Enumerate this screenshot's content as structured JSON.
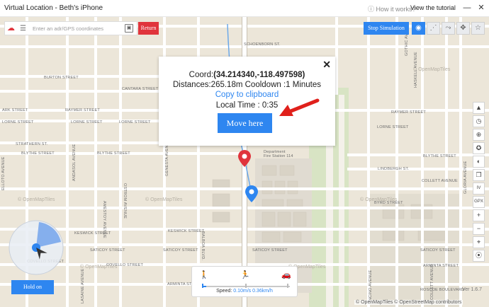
{
  "window": {
    "title": "Virtual Location - Beth's iPhone",
    "how_it_works": "How it works?",
    "tutorial": "View the tutorial"
  },
  "toolbar": {
    "search_placeholder": "Enter an adr/GPS coordinates",
    "return_label": "Return",
    "stop_label": "Stop Simulation"
  },
  "popup": {
    "coord_prefix": "Coord:",
    "coord_value": "(34.214340,-118.497598)",
    "distance": "Distances:265.18m Cooldown :1 Minutes",
    "copy": "Copy to clipboard",
    "local_time": "Local Time : 0:35",
    "move_button": "Move here",
    "close": "✕"
  },
  "hold_button": "Hold on",
  "speed": {
    "label": "Speed:",
    "value": "0.10m/s 0.36km/h"
  },
  "map": {
    "streets": [
      "SCHOENBORN ST.",
      "BURTON STREET",
      "CANTARA STREET",
      "RAYMER STREET",
      "LORNE STREET",
      "KITTRIDGE STREET",
      "STRATHERN ST.",
      "BLYTHE STREET",
      "LINDBERGH ST.",
      "BYRD STREET",
      "KESWICK STREET",
      "SATICOY STREET",
      "COVELLO STREET",
      "ARMINTA STREET",
      "ROSCOE BOULEVARD"
    ],
    "avenues": [
      "GOTHIC AVENUE",
      "HASKELL AVENUE",
      "GENESTA AVENUE",
      "BALBOA BLVD.",
      "AMESTOY AVENUE",
      "OSTROM AVENUE",
      "ANDASOL AVENUE",
      "ENCINO AVENUE",
      "COLLETT AVENUE",
      "GLORIA AVENUE",
      "LASAINE AVENUE"
    ],
    "labels": [
      "Department Fire Station 114"
    ],
    "watermark": "© OpenMapTiles",
    "attribution": "© OpenMapTiles © OpenStreetMap contributors",
    "version": "Ver 1.6.7"
  },
  "side_tools": [
    "maps-icon",
    "history-icon",
    "pin-icon",
    "compass-icon",
    "toggle-icon",
    "copy-icon",
    "IV",
    "GPX",
    "zoom-in",
    "zoom-out",
    "locate-icon",
    "location-pin-icon"
  ],
  "colors": {
    "accent": "#2e86f0",
    "return": "#e0343c",
    "map_bg": "#ece6d9",
    "street": "#ffffff"
  }
}
